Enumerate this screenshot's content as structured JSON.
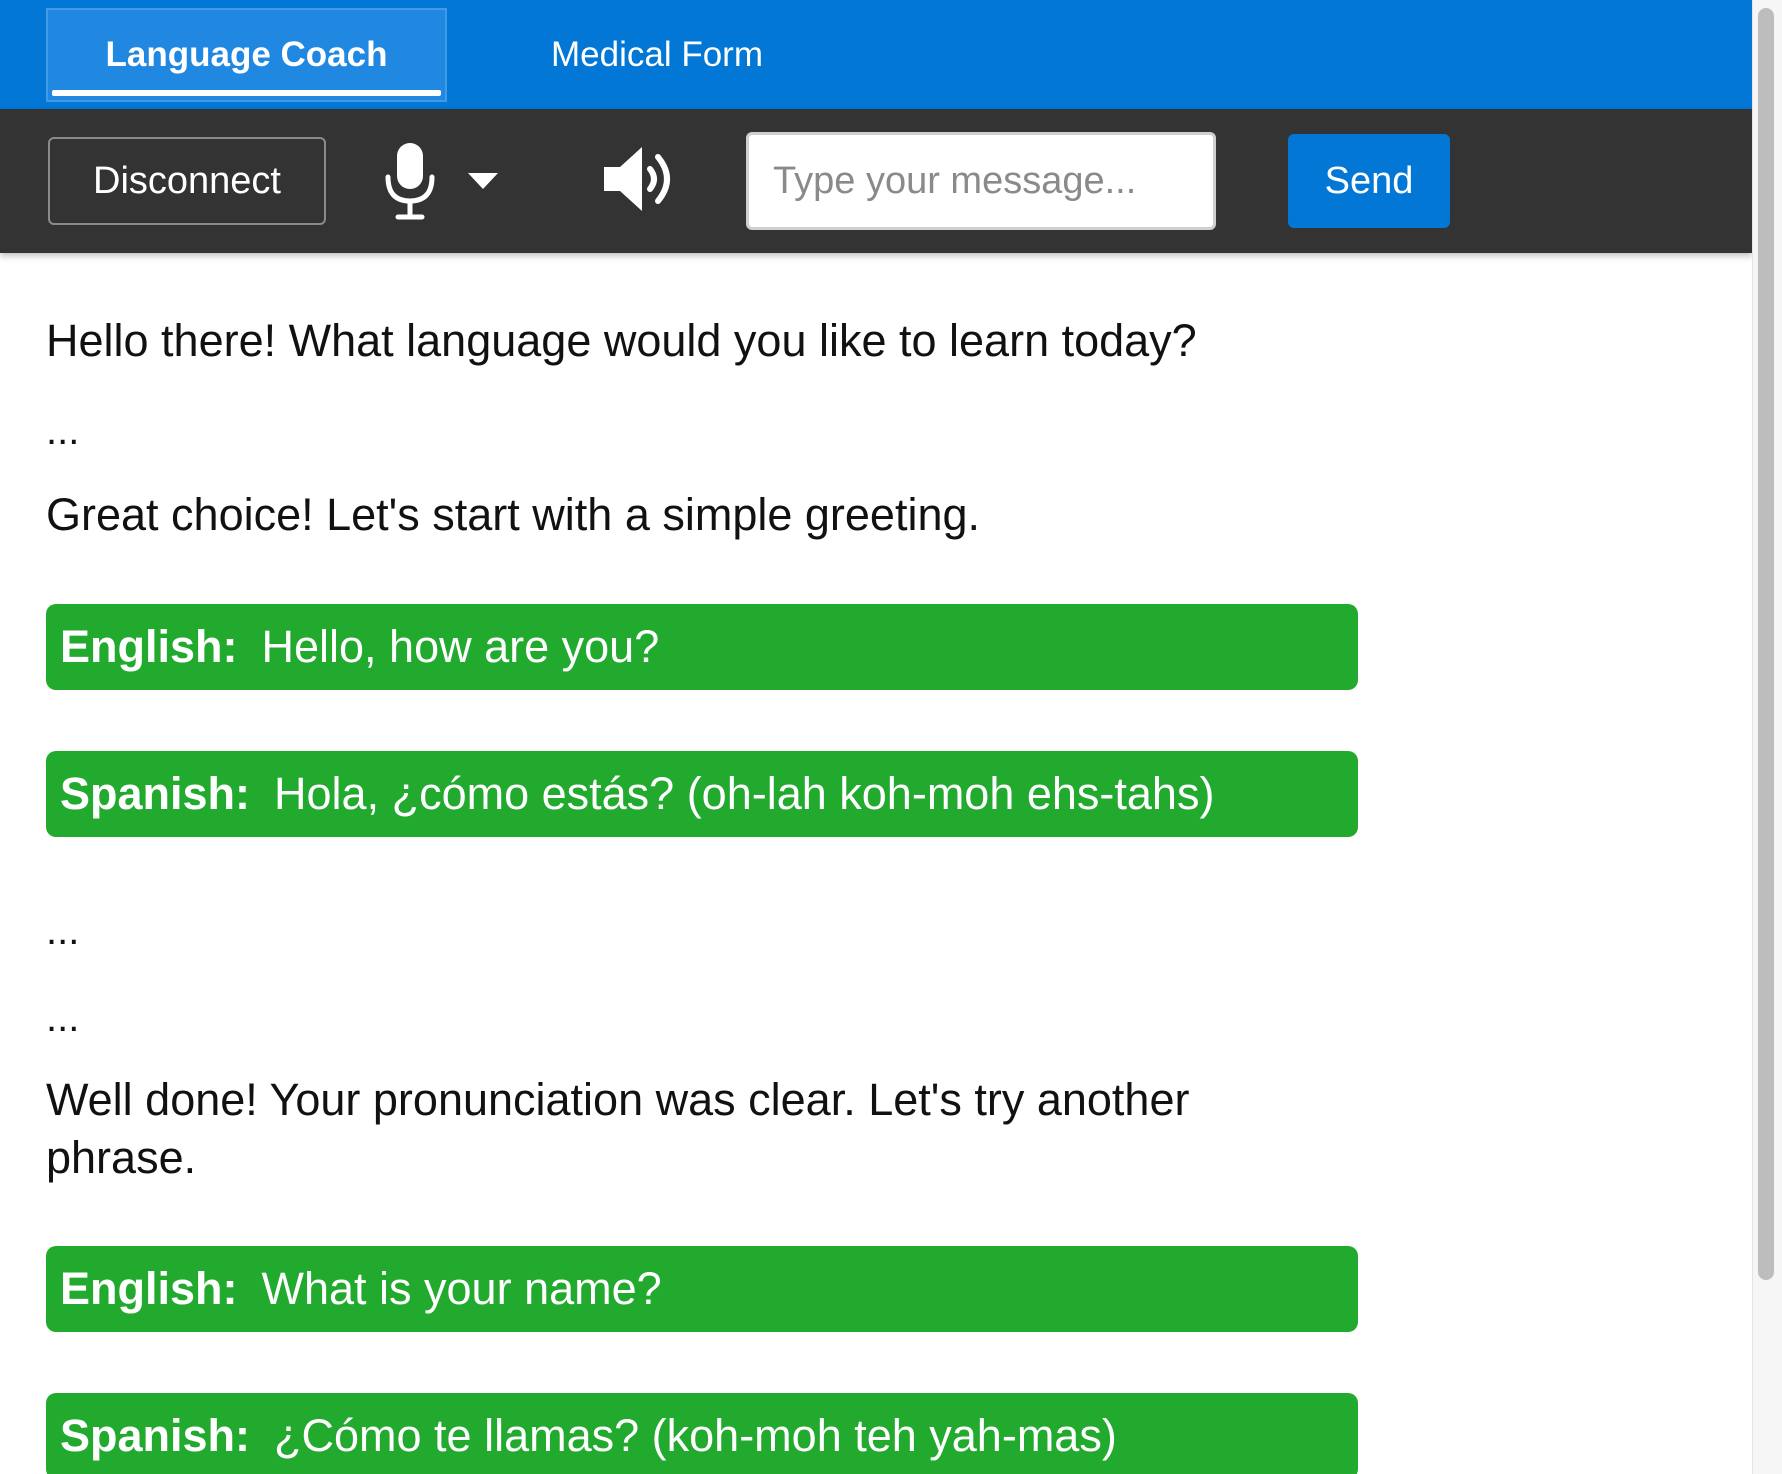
{
  "tabs": [
    {
      "label": "Language Coach",
      "active": true
    },
    {
      "label": "Medical Form",
      "active": false
    }
  ],
  "toolbar": {
    "disconnect_label": "Disconnect",
    "mic_icon": "microphone-icon",
    "mic_menu_icon": "chevron-down-icon",
    "speaker_icon": "speaker-icon",
    "input_value": "",
    "input_placeholder": "Type your message...",
    "send_label": "Send"
  },
  "conversation": {
    "m1": "Hello there! What language would you like to learn today?",
    "e1": "...",
    "m2": "Great choice! Let's start with a simple greeting.",
    "p1": {
      "lang": "English:",
      "text": "Hello, how are you?"
    },
    "p2": {
      "lang": "Spanish:",
      "text": "Hola, ¿cómo estás? (oh-lah koh-moh ehs-tahs)"
    },
    "e2": "...",
    "e3": "...",
    "m3": "Well done! Your pronunciation was clear. Let's try another phrase.",
    "p3": {
      "lang": "English:",
      "text": "What is your name?"
    },
    "p4": {
      "lang": "Spanish:",
      "text": "¿Cómo te llamas? (koh-moh teh yah-mas)"
    }
  },
  "colors": {
    "brand_blue": "#0277d6",
    "toolbar_dark": "#333333",
    "phrase_green": "#22aa2f"
  }
}
